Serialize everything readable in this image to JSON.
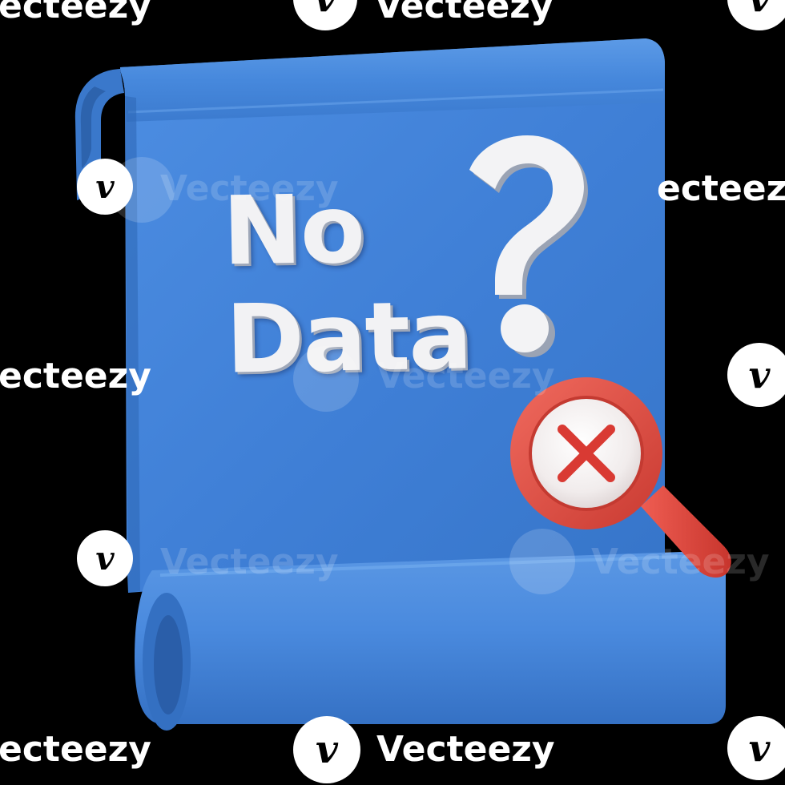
{
  "illustration": {
    "line1": "No",
    "line2": "Data",
    "question_mark": "?",
    "document_color": "#3f7fd6",
    "magnifier_color": "#e0463c",
    "cross_color": "#d93a33"
  },
  "watermark": {
    "brand": "Vecteezy",
    "brand_partial_left": "ecteezy",
    "logo_glyph": "v"
  }
}
